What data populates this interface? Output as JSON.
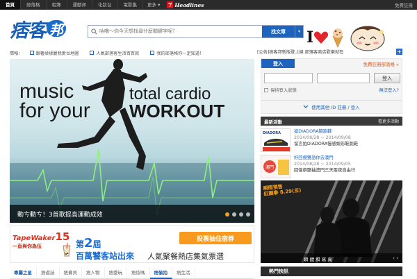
{
  "topnav": {
    "items": [
      "首頁",
      "部落格",
      "相簿",
      "運動邦",
      "化妝台",
      "電影集"
    ],
    "more": "更多 ▾",
    "seven": "7",
    "headlines": "Headlines",
    "register": "免費註冊"
  },
  "header": {
    "logo_text": "痞客",
    "logo_bubble": "邦",
    "search_placeholder": "咕噜～你今天想找尋什麼關鍵字呢？",
    "search_button": "找文章",
    "search_dropdown": "▾",
    "i_text": "I"
  },
  "ticker": {
    "label": "情報：",
    "items": [
      "跟著揉揉麗我愛台地圖",
      "人氣部落客生活百百款",
      "我的部落格你一定知道！"
    ],
    "announcement": "[公告]痞客邦新版登上線 部落客商店歡樂就在"
  },
  "hero": {
    "line1": "music",
    "line2": "for your",
    "line3": "total cardio",
    "line4": "WORKOUT",
    "caption": "動ㄘ動ㄘ！3首歌提高運動成效",
    "active_dot": 0,
    "dot_count": 4
  },
  "banner": {
    "brand1": "TapeWaker",
    "brand15": "15",
    "brand2": "一直與你為伍",
    "edition_pre": "第",
    "edition_num": "2",
    "edition_post": "屆",
    "title": "百萬饕客站出來",
    "subtitle": "人氣聚餐熱店集氣票選",
    "vote": "投票抽住宿券"
  },
  "tabs": {
    "items": [
      "專屬之星",
      "痞遊誌",
      "痞寶貝",
      "痞人物",
      "痞愛玩",
      "痞炫嗎",
      "痞偷拍",
      "痞生活"
    ],
    "active": 6
  },
  "login": {
    "button": "登入",
    "free_register": "免費註冊部落格 »",
    "submit": "登入",
    "remember": "保持登入狀態",
    "forgot": "無法登入?",
    "other_id": "使用其他 ID 註冊 / 登入"
  },
  "activities": {
    "header": "最新活動",
    "more": "看更多活動",
    "items": [
      {
        "title": "搶DIADORA鞋跑鞋",
        "date": "2014/08/28 ~ 2014/09/08",
        "desc": "留言拍DIADORA慢感娛彩鞋跑鞋"
      },
      {
        "title": "好回億雙語你去澳門",
        "date": "2014/08/28 ~ 2014/09/05",
        "desc": "回憶祭題抽澳門三天兩夜自由行"
      }
    ],
    "promo": "瞬間預售\n紅圈拳 8.29(五)",
    "photo_caption": "瞬 間 和 寫 真",
    "photo_arrows": "‹ ›"
  },
  "hot": {
    "header": "熱門快訊"
  }
}
